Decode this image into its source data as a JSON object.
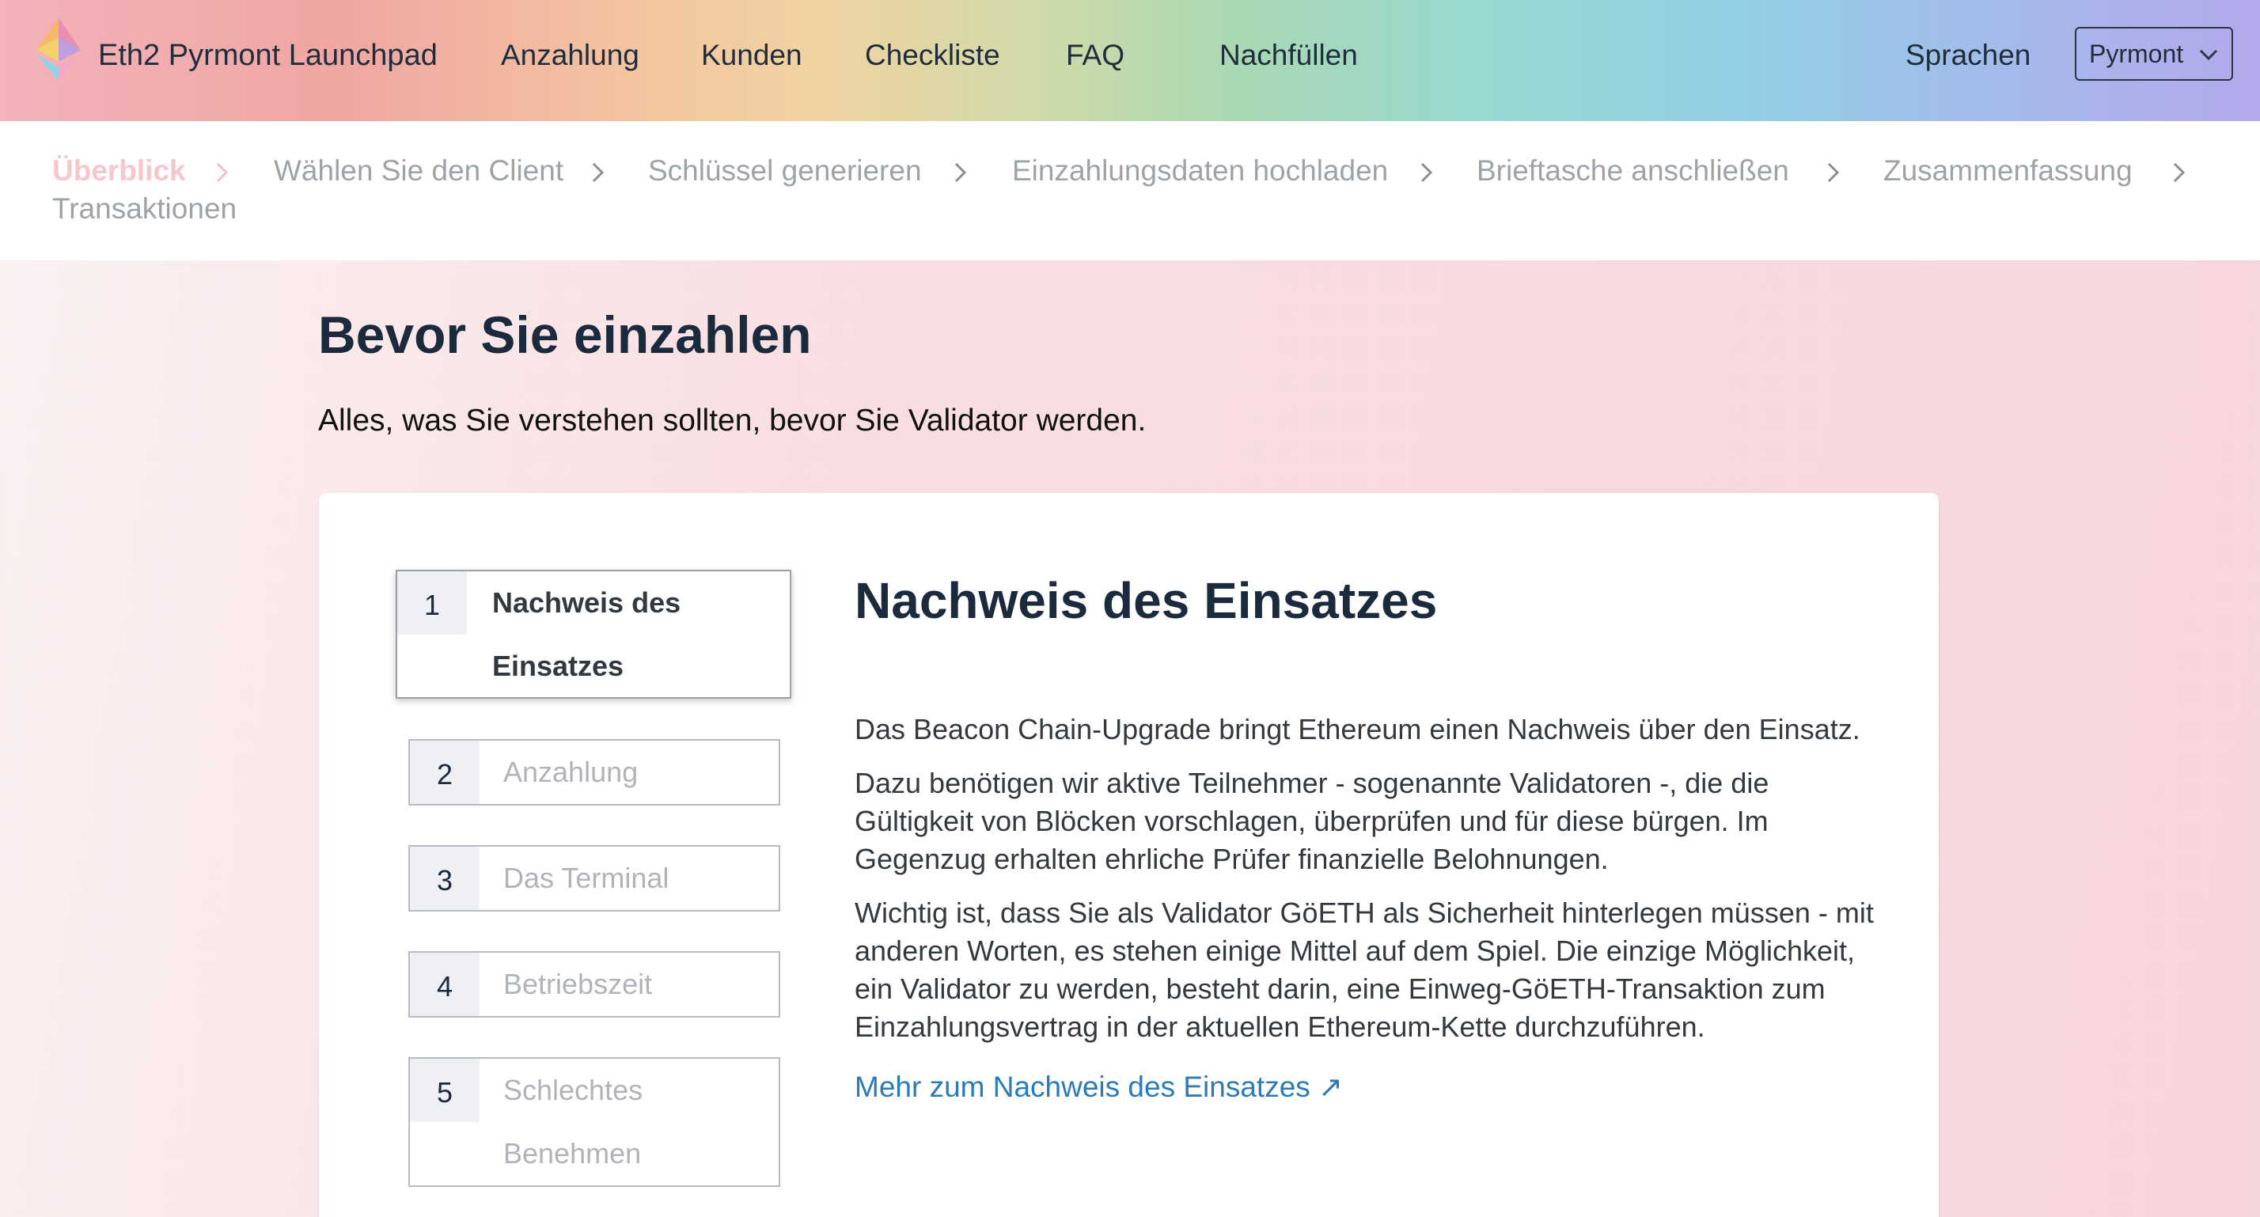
{
  "header": {
    "brand": "Eth2 Pyrmont Launchpad",
    "nav": [
      "Anzahlung",
      "Kunden",
      "Checkliste",
      "FAQ",
      "Nachfüllen"
    ],
    "language_label": "Sprachen",
    "network_select": "Pyrmont"
  },
  "steps": [
    "Überblick",
    "Wählen Sie den Client",
    "Schlüssel generieren",
    "Einzahlungsdaten hochladen",
    "Brieftasche anschließen",
    "Zusammenfassung",
    "Transaktionen"
  ],
  "page": {
    "title": "Bevor Sie einzahlen",
    "subtitle": "Alles, was Sie verstehen sollten, bevor Sie Validator werden."
  },
  "tabs": [
    {
      "number": "1",
      "label": "Nachweis des Einsatzes"
    },
    {
      "number": "2",
      "label": "Anzahlung"
    },
    {
      "number": "3",
      "label": "Das Terminal"
    },
    {
      "number": "4",
      "label": "Betriebszeit"
    },
    {
      "number": "5",
      "label": "Schlechtes Benehmen"
    }
  ],
  "content": {
    "title": "Nachweis des Einsatzes",
    "paragraphs": [
      "Das Beacon Chain-Upgrade bringt Ethereum einen Nachweis über den Einsatz.",
      "Dazu benötigen wir aktive Teilnehmer - sogenannte Validatoren -, die die Gültigkeit von Blöcken vorschlagen, überprüfen und für diese bürgen. Im Gegenzug erhalten ehrliche Prüfer finanzielle Belohnungen.",
      "Wichtig ist, dass Sie als Validator GöETH als Sicherheit hinterlegen müssen - mit anderen Worten, es stehen einige Mittel auf dem Spiel. Die einzige Möglichkeit, ein Validator zu werden, besteht darin, eine Einweg-GöETH-Transaktion zum Einzahlungsvertrag in der aktuellen Ethereum-Kette durchzuführen."
    ],
    "link": "Mehr zum Nachweis des Einsatzes ↗"
  }
}
